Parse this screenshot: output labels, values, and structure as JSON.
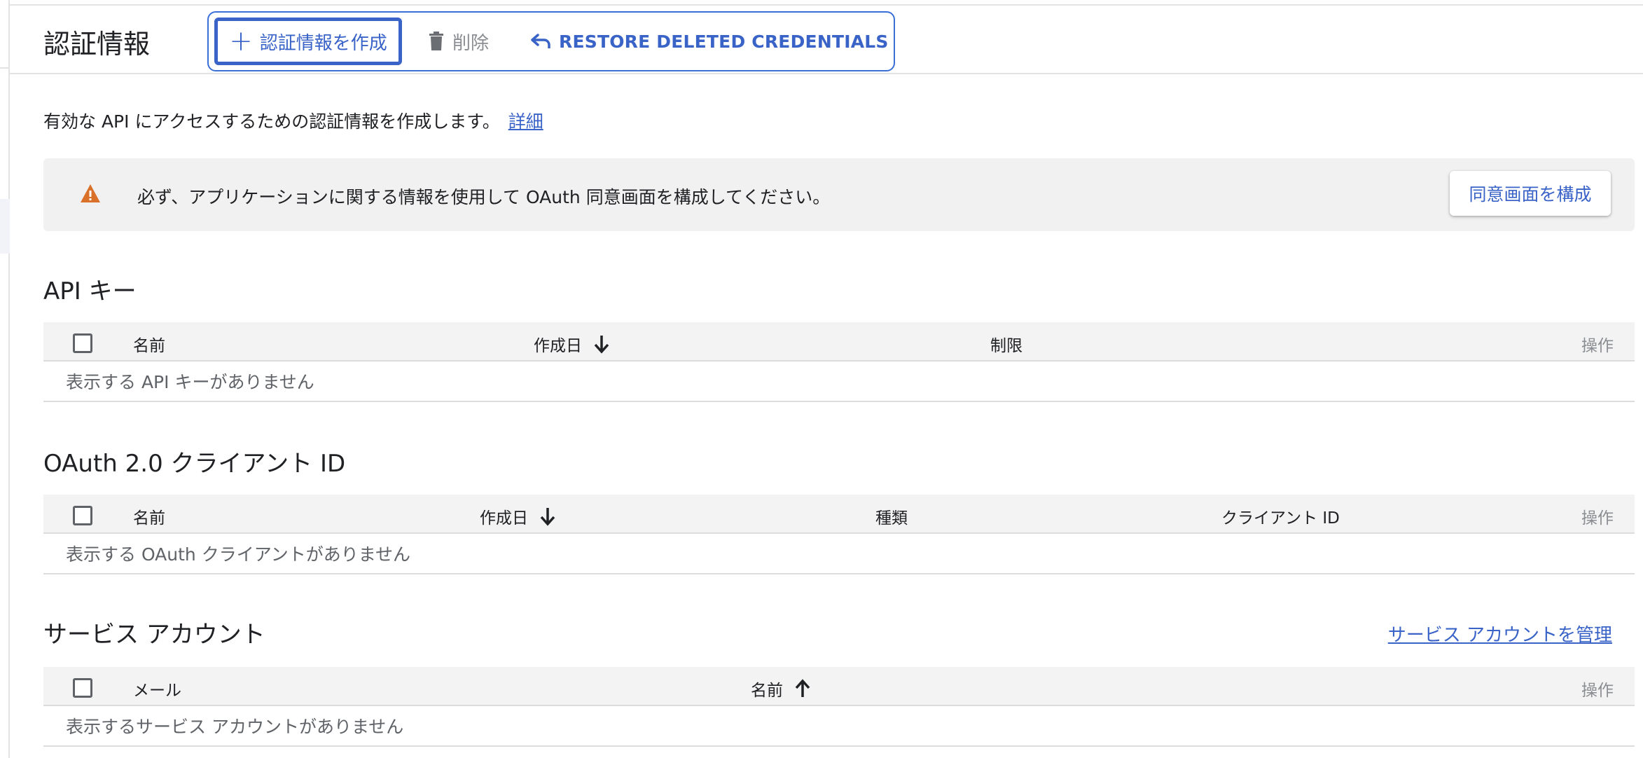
{
  "header": {
    "title": "認証情報",
    "create_label": "認証情報を作成",
    "delete_label": "削除",
    "restore_label": "RESTORE DELETED CREDENTIALS"
  },
  "intro": {
    "text": "有効な API にアクセスするための認証情報を作成します。",
    "link": "詳細"
  },
  "banner": {
    "message": "必ず、アプリケーションに関する情報を使用して OAuth 同意画面を構成してください。",
    "button": "同意画面を構成"
  },
  "api_keys": {
    "title": "API キー",
    "columns": [
      "名前",
      "作成日",
      "制限"
    ],
    "actions": "操作",
    "empty": "表示する API キーがありません"
  },
  "oauth": {
    "title": "OAuth 2.0 クライアント ID",
    "columns": [
      "名前",
      "作成日",
      "種類",
      "クライアント ID"
    ],
    "actions": "操作",
    "empty": "表示する OAuth クライアントがありません"
  },
  "service_accounts": {
    "title": "サービス アカウント",
    "manage_link": "サービス アカウントを管理",
    "columns": [
      "メール",
      "名前"
    ],
    "actions": "操作",
    "empty": "表示するサービス アカウントがありません"
  },
  "colors": {
    "accent": "#3a63c8",
    "warning": "#d9712a",
    "header_bg": "#f3f3f3"
  }
}
